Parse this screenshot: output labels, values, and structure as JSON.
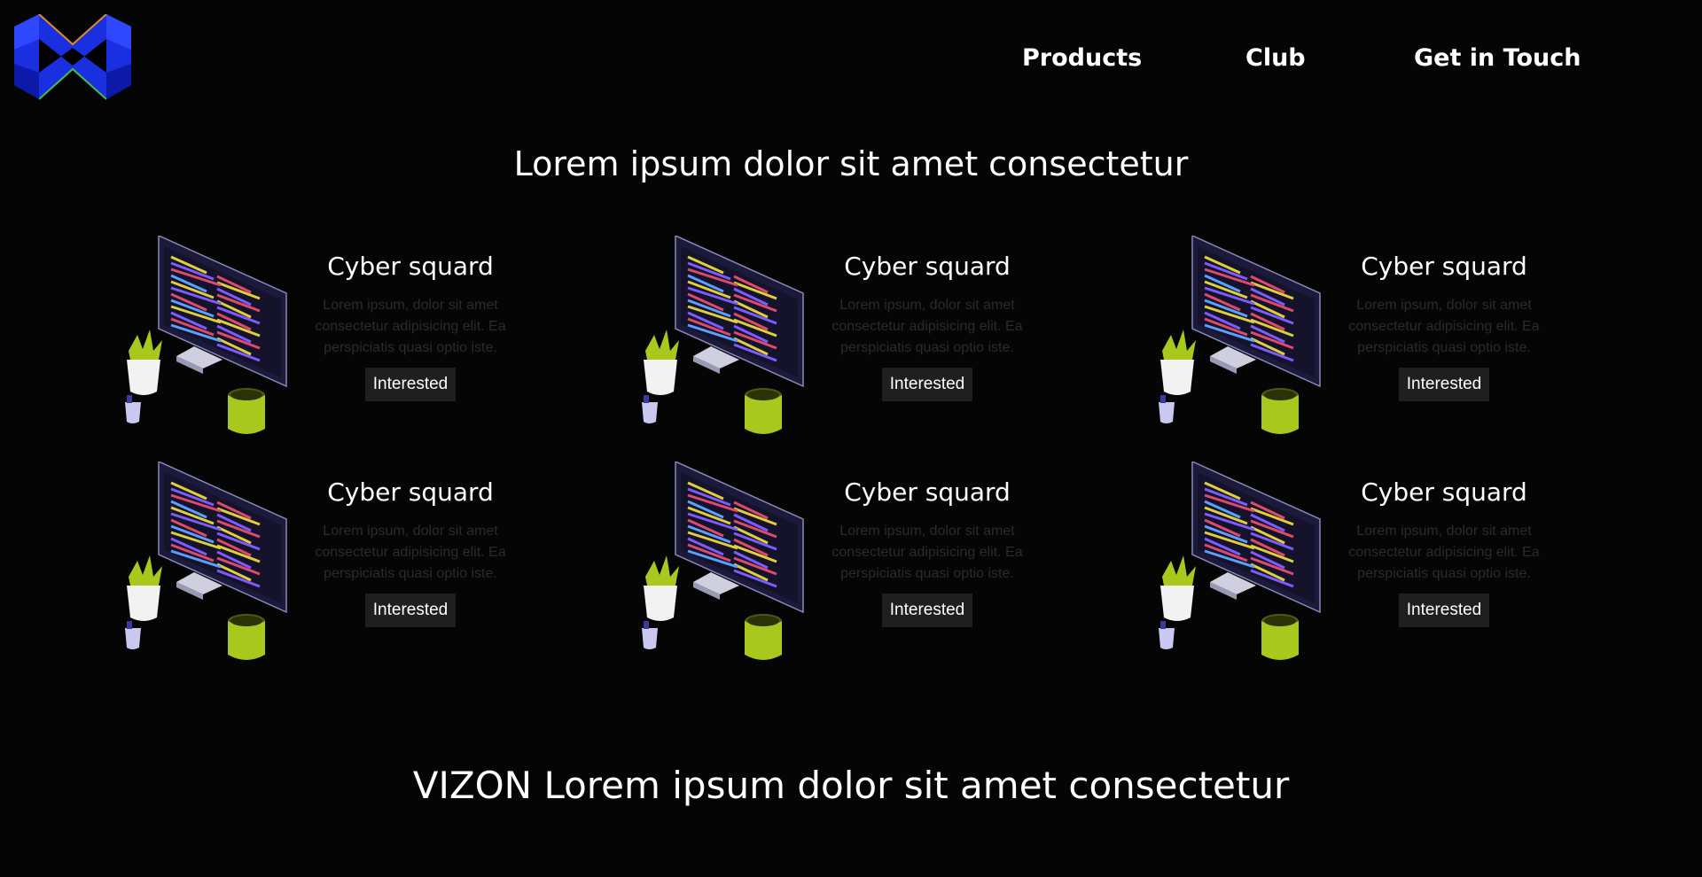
{
  "header": {
    "logo_icon": "vizon-logo-icon",
    "nav": [
      {
        "label": "Products"
      },
      {
        "label": "Club"
      },
      {
        "label": "Get in Touch"
      }
    ]
  },
  "hero": {
    "title": "Lorem ipsum dolor sit amet consectetur"
  },
  "cards": [
    {
      "title": "Cyber squard",
      "description": "Lorem ipsum, dolor sit amet consectetur adipisicing elit. Ea perspiciatis quasi optio iste.",
      "button": "Interested",
      "icon": "developer-desk-illustration"
    },
    {
      "title": "Cyber squard",
      "description": "Lorem ipsum, dolor sit amet consectetur adipisicing elit. Ea perspiciatis quasi optio iste.",
      "button": "Interested",
      "icon": "developer-desk-illustration"
    },
    {
      "title": "Cyber squard",
      "description": "Lorem ipsum, dolor sit amet consectetur adipisicing elit. Ea perspiciatis quasi optio iste.",
      "button": "Interested",
      "icon": "developer-desk-illustration"
    },
    {
      "title": "Cyber squard",
      "description": "Lorem ipsum, dolor sit amet consectetur adipisicing elit. Ea perspiciatis quasi optio iste.",
      "button": "Interested",
      "icon": "developer-desk-illustration"
    },
    {
      "title": "Cyber squard",
      "description": "Lorem ipsum, dolor sit amet consectetur adipisicing elit. Ea perspiciatis quasi optio iste.",
      "button": "Interested",
      "icon": "developer-desk-illustration"
    },
    {
      "title": "Cyber squard",
      "description": "Lorem ipsum, dolor sit amet consectetur adipisicing elit. Ea perspiciatis quasi optio iste.",
      "button": "Interested",
      "icon": "developer-desk-illustration"
    }
  ],
  "footer": {
    "title": "VIZON Lorem ipsum dolor sit amet consectetur"
  },
  "colors": {
    "background": "#050505",
    "text": "#ffffff",
    "muted_text": "#2b2b2b",
    "button_bg": "#1f1f1f",
    "accent_green": "#a8c81e",
    "logo_blue": "#1a2fe0"
  }
}
